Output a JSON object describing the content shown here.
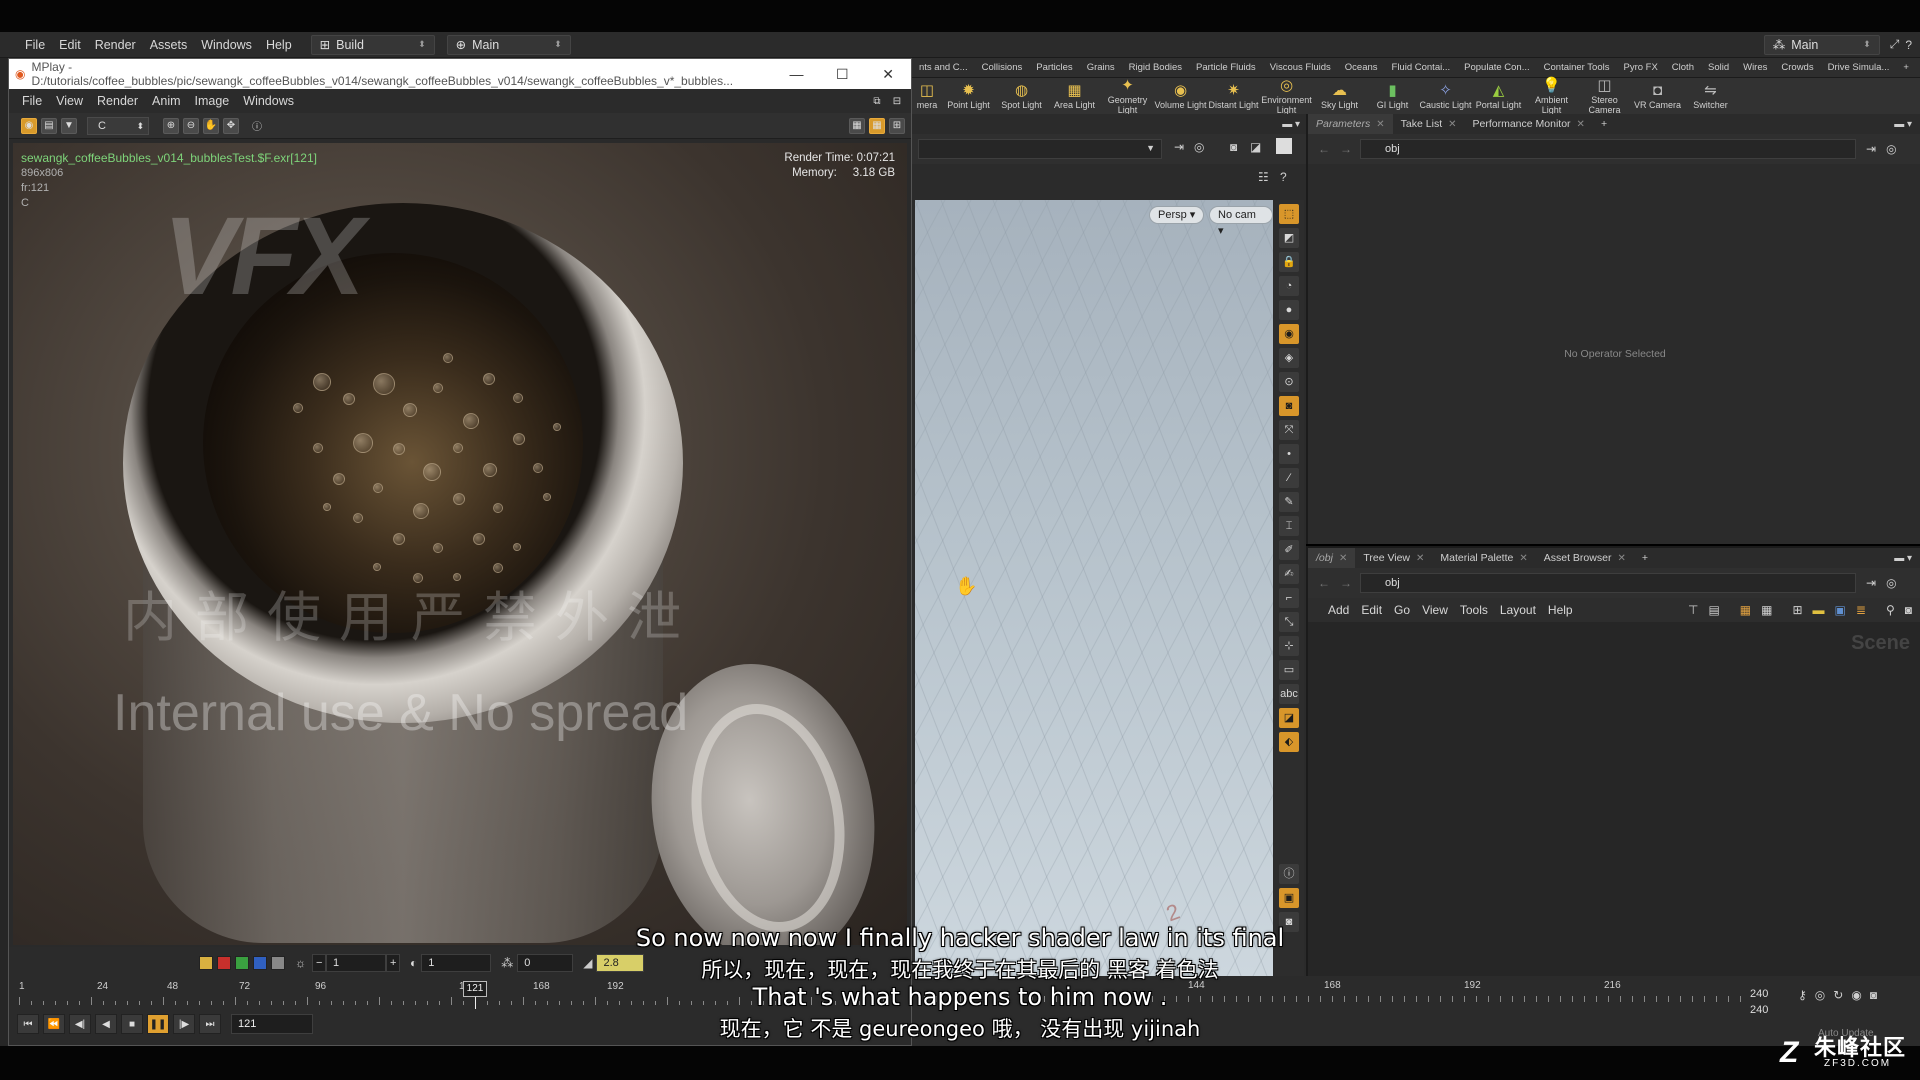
{
  "menubar": {
    "items": [
      "File",
      "Edit",
      "Render",
      "Assets",
      "Windows",
      "Help"
    ],
    "desktop_build": "Build",
    "desktop_main": "Main",
    "right_desktop": "Main"
  },
  "mplay": {
    "title": "MPlay - D:/tutorials/coffee_bubbles/pic/sewangk_coffeeBubbles_v014/sewangk_coffeeBubbles_v014/sewangk_coffeeBubbles_v*_bubbles...",
    "menu": [
      "File",
      "View",
      "Render",
      "Anim",
      "Image",
      "Windows"
    ],
    "channel": "C",
    "render_info": {
      "filename": "sewangk_coffeeBubbles_v014_bubblesTest.$F.exr[121]",
      "resolution": "896x806",
      "frame": "fr:121",
      "channel": "C",
      "render_time_label": "Render Time:",
      "render_time": "0:07:21",
      "memory_label": "Memory:",
      "memory": "3.18 GB"
    },
    "watermark": {
      "logo": "VFX",
      "cn": "内部使用严禁外泄",
      "en": "Internal use & No spread"
    },
    "controls": {
      "field1": "1",
      "field2": "1",
      "field3": "0",
      "gamma": "2.8",
      "timeline_ticks": [
        "1",
        "24",
        "48",
        "72",
        "96",
        "144",
        "168",
        "192"
      ],
      "current_frame_marker": "121",
      "current_frame": "121"
    }
  },
  "shelf": {
    "tabs": [
      "nts and C...",
      "Collisions",
      "Particles",
      "Grains",
      "Rigid Bodies",
      "Particle Fluids",
      "Viscous Fluids",
      "Oceans",
      "Fluid Contai...",
      "Populate Con...",
      "Container Tools",
      "Pyro FX",
      "Cloth",
      "Solid",
      "Wires",
      "Crowds",
      "Drive Simula..."
    ],
    "tools": [
      "mera",
      "Point Light",
      "Spot Light",
      "Area Light",
      "Geometry Light",
      "Volume Light",
      "Distant Light",
      "Environment Light",
      "Sky Light",
      "GI Light",
      "Caustic Light",
      "Portal Light",
      "Ambient Light",
      "Stereo Camera",
      "VR Camera",
      "Switcher"
    ]
  },
  "viewport": {
    "persp_label": "Persp",
    "cam_label": "No cam",
    "grid_labels": [
      "2"
    ]
  },
  "params_pane": {
    "tabs": [
      "Parameters",
      "Take List",
      "Performance Monitor"
    ],
    "path": "obj",
    "empty_message": "No Operator Selected"
  },
  "network_pane": {
    "tabs": [
      "/obj",
      "Tree View",
      "Material Palette",
      "Asset Browser"
    ],
    "path": "obj",
    "menu": [
      "Add",
      "Edit",
      "Go",
      "View",
      "Tools",
      "Layout",
      "Help"
    ],
    "context_label": "Scene"
  },
  "main_timeline": {
    "ticks": [
      "144",
      "168",
      "192",
      "216"
    ],
    "end_frame_1": "240",
    "end_frame_2": "240",
    "auto_update": "Auto Update"
  },
  "subtitles": {
    "en1": "So now now now I finally hacker shader law in its final",
    "cn1": "所以，现在，现在，现在我终于在其最后的 黑客 着色法",
    "en2": "That 's what happens to him now .",
    "cn2": "现在，它 不是 geureongeo 哦， 没有出现 yijinah"
  },
  "logo": {
    "name": "朱峰社区",
    "url": "ZF3D.COM"
  },
  "colors": {
    "accent_orange": "#d8962a",
    "mplay_filename_green": "#7ed47a",
    "gamma_field": "#d8cf68"
  }
}
